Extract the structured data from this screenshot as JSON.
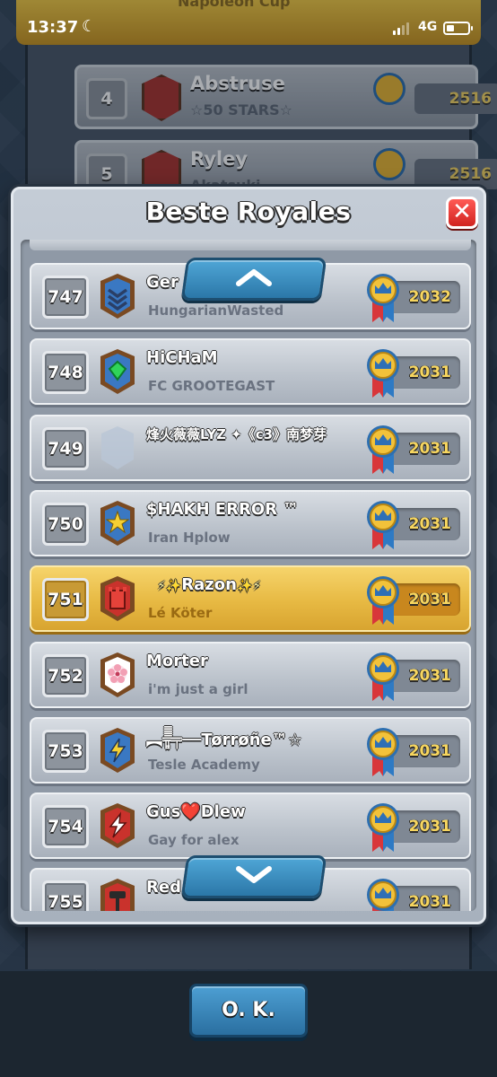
{
  "status_bar": {
    "time": "13:37",
    "moon_icon": "☾",
    "network": "4G"
  },
  "background": {
    "top_name": "Napoleon Cup",
    "rows": [
      {
        "rank": "4",
        "name": "Abstruse",
        "clan": "☆50 STARS☆",
        "trophies": "2516"
      },
      {
        "rank": "5",
        "name": "Ryley",
        "clan": "Akatsuki",
        "trophies": "2516"
      }
    ]
  },
  "modal": {
    "title": "Beste Royales",
    "close_label": "✕",
    "players": [
      {
        "rank": "747",
        "name": "Ger",
        "clan": "HungarianWasted",
        "trophies": "2032",
        "badge": "chevron-badge",
        "badge_color": "#3a78c2",
        "badge_emblem": "#2a3f66",
        "highlight": false
      },
      {
        "rank": "748",
        "name": "HiCHaM",
        "clan": "FC GROOTEGAST",
        "trophies": "2031",
        "badge": "gem-badge",
        "badge_color": "#3a78c2",
        "badge_emblem": "#2fd45a",
        "highlight": false
      },
      {
        "rank": "749",
        "name": "烽火薇薇LYZ ✦《c3》南梦芽",
        "clan": "",
        "trophies": "2031",
        "badge": "empty-badge",
        "badge_color": "#b9c6d6",
        "badge_emblem": "#b9c6d6",
        "highlight": false
      },
      {
        "rank": "750",
        "name": "$HAKH ERROR ™",
        "clan": "Iran Hplow",
        "trophies": "2031",
        "badge": "star-badge",
        "badge_color": "#3a78c2",
        "badge_emblem": "#f5d033",
        "highlight": false
      },
      {
        "rank": "751",
        "name": "Razon",
        "name_prefix": "⚡✨",
        "name_suffix": "✨⚡",
        "clan": "Lé Köter",
        "trophies": "2031",
        "badge": "tower-badge",
        "badge_color": "#c9322c",
        "badge_emblem": "#e5423a",
        "highlight": true
      },
      {
        "rank": "752",
        "name": "Morter",
        "clan": "i'm just a girl",
        "trophies": "2031",
        "badge": "flower-badge",
        "badge_color": "#ffffff",
        "badge_emblem": "#f29fb4",
        "highlight": false
      },
      {
        "rank": "753",
        "name": "︻╦̵̵͇̿̿̿̿╤──Tørrøñe™☆",
        "clan": "Tesle Academy",
        "trophies": "2031",
        "badge": "bolt-badge",
        "badge_color": "#3a78c2",
        "badge_emblem": "#f5d033",
        "highlight": false
      },
      {
        "rank": "754",
        "name": "Gus❤️Dlew",
        "clan": "Gay for alex",
        "trophies": "2031",
        "badge": "lightning-badge",
        "badge_color": "#c9322c",
        "badge_emblem": "#ffffff",
        "highlight": false
      },
      {
        "rank": "755",
        "name": "Red",
        "clan": "",
        "trophies": "2031",
        "badge": "hammer-badge",
        "badge_color": "#c9322c",
        "badge_emblem": "#2a2a2a",
        "highlight": false
      }
    ]
  },
  "ok_button": {
    "label": "O. K."
  }
}
